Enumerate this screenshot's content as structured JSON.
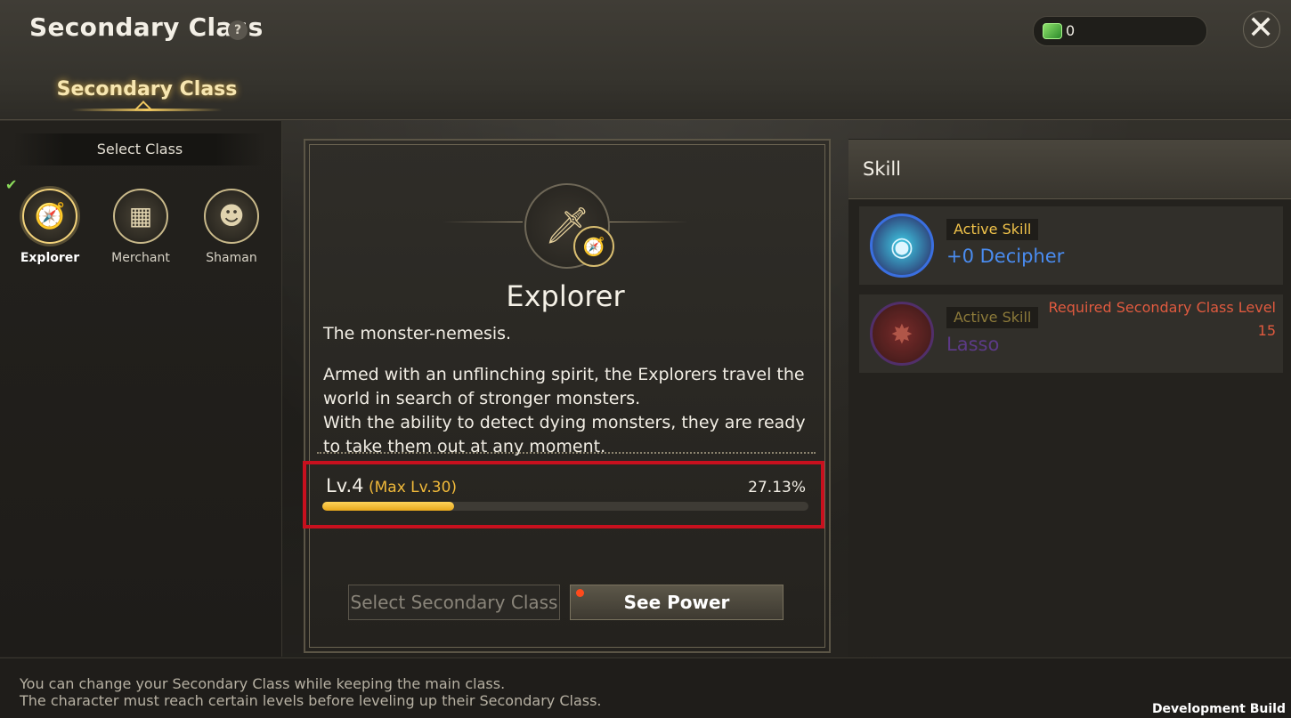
{
  "header": {
    "title": "Secondary Class",
    "help_glyph": "?",
    "currency_amount": "0",
    "close_glyph": "✕",
    "tab_label": "Secondary Class"
  },
  "left_panel": {
    "select_label": "Select Class",
    "check_glyph": "✔",
    "classes": [
      {
        "name": "Explorer",
        "icon": "compass-icon",
        "glyph": "🧭",
        "selected": true
      },
      {
        "name": "Merchant",
        "icon": "coins-icon",
        "glyph": "▦",
        "selected": false
      },
      {
        "name": "Shaman",
        "icon": "mask-icon",
        "glyph": "☻",
        "selected": false
      }
    ]
  },
  "class_detail": {
    "emblem_icon": "sword-icon",
    "emblem_glyph": "🗡",
    "badge_icon": "compass-badge-icon",
    "badge_glyph": "🧭",
    "name": "Explorer",
    "tagline": "The monster-nemesis.",
    "description_lines": [
      "Armed with an unflinching spirit, the Explorers travel the",
      "world in search of stronger monsters.",
      "With the ability to detect dying monsters, they are ready",
      "to take them out at any moment."
    ],
    "level": "Lv.4",
    "max_level": "(Max Lv.30)",
    "progress_percent_label": "27.13%",
    "progress_fraction": 0.2713,
    "select_button": "Select Secondary Class",
    "see_power_button": "See Power"
  },
  "skills": {
    "heading": "Skill",
    "items": [
      {
        "type": "Active Skill",
        "name": "+0 Decipher",
        "icon": "decipher-icon",
        "glyph": "◉",
        "locked": false,
        "name_color": "#4a8cf0"
      },
      {
        "type": "Active Skill",
        "name": "Lasso",
        "icon": "lasso-icon",
        "glyph": "✸",
        "locked": true,
        "name_color": "#6a3a9a",
        "requirement_line1": "Required Secondary Class Level",
        "requirement_line2": "15"
      }
    ]
  },
  "footer": {
    "line1": "You can change your Secondary Class while keeping the main class.",
    "line2": "The character must reach certain levels before leveling up their Secondary Class.",
    "dev_build": "Development Build"
  },
  "colors": {
    "accent_gold": "#f0b93a",
    "highlight_red": "#c8101e",
    "requirement_red": "#e05a3f"
  }
}
